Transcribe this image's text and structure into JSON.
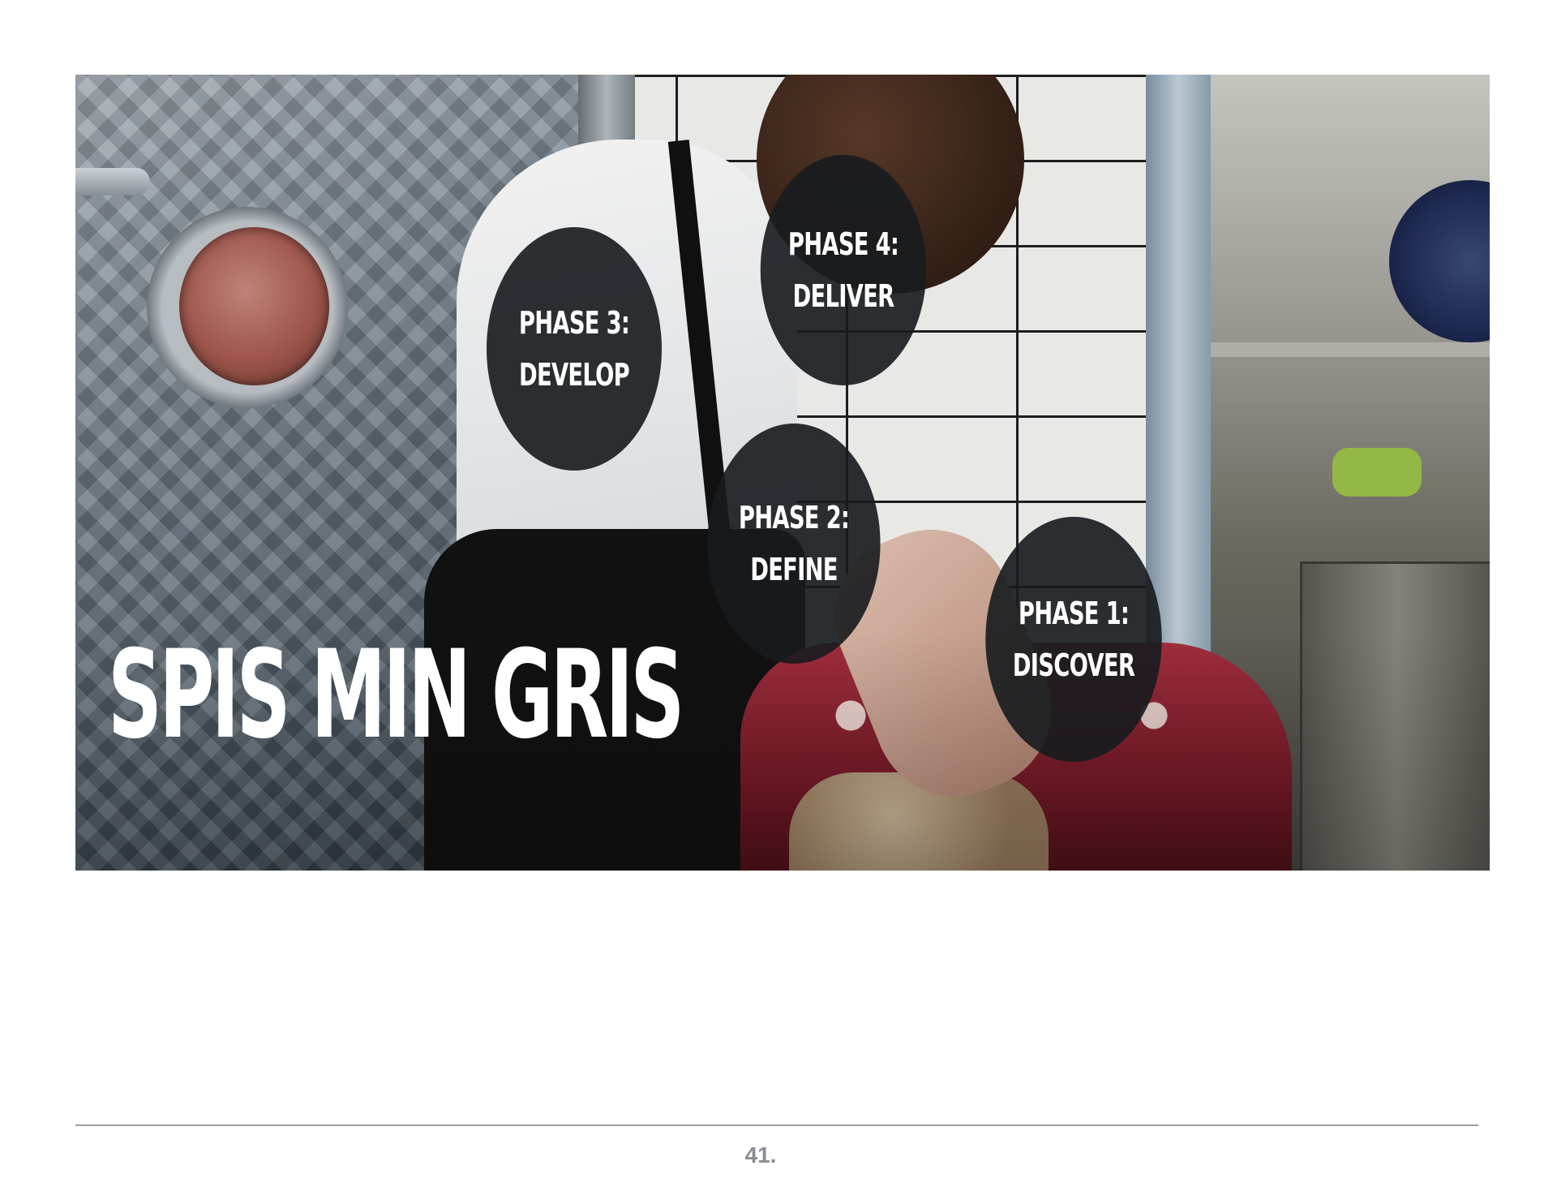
{
  "slide": {
    "title": "SPIS MIN GRIS",
    "phases": [
      {
        "line1": "PHASE 1:",
        "line2": "DISCOVER"
      },
      {
        "line1": "PHASE 2:",
        "line2": "DEFINE"
      },
      {
        "line1": "PHASE 3:",
        "line2": "DEVELOP"
      },
      {
        "line1": "PHASE 4:",
        "line2": "DELIVER"
      }
    ],
    "background_image": "chef-butchering-meat-kitchen-photo"
  },
  "footer": {
    "page_number": "41."
  },
  "colors": {
    "circle_fill": "#181b1f",
    "text": "#ffffff",
    "footer_text": "#8a8e93",
    "rule": "#9a9ca0"
  }
}
